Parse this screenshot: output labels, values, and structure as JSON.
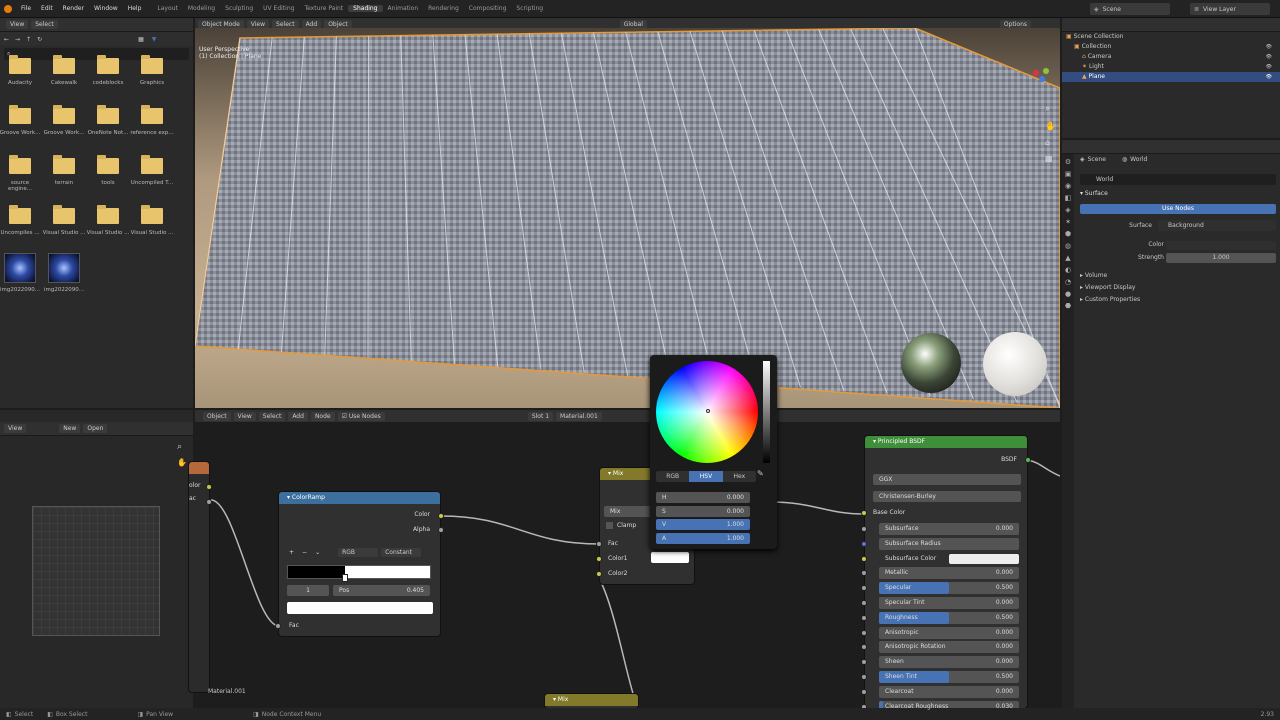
{
  "topbar": {
    "menu": [
      "File",
      "Edit",
      "Render",
      "Window",
      "Help"
    ],
    "workspaces": [
      "Layout",
      "Modeling",
      "Sculpting",
      "UV Editing",
      "Texture Paint",
      "Shading",
      "Animation",
      "Rendering",
      "Compositing",
      "Scripting"
    ],
    "active_workspace": "Shading",
    "scene": "Scene",
    "view_layer": "View Layer"
  },
  "file_browser": {
    "menu": [
      "View",
      "Select"
    ],
    "files": [
      "Audacity",
      "Cakewalk",
      "codeblocks",
      "Graphics",
      "Groove Work...",
      "Groove Work...",
      "OneNote Not...",
      "reference exp...",
      "source engine...",
      "terrain",
      "tools",
      "Uncompiled T...",
      "Uncompiles ...",
      "Visual Studio ...",
      "Visual Studio ...",
      "Visual Studio ..."
    ],
    "images": [
      "img2022090...",
      "img2022090..."
    ]
  },
  "viewport": {
    "mode": "Object Mode",
    "menu": [
      "View",
      "Select",
      "Add",
      "Object"
    ],
    "info_line1": "User Perspective",
    "info_line2": "(1) Collection | Plane",
    "orientation": "Global",
    "options": "Options"
  },
  "outliner": {
    "items": [
      "Scene Collection",
      "Collection",
      "Camera",
      "Light",
      "Plane"
    ]
  },
  "properties": {
    "scene_tab": "Scene",
    "world_tab": "World",
    "world_name": "World",
    "surface_section": "Surface",
    "use_nodes": "Use Nodes",
    "surface_label": "Surface",
    "surface_value": "Background",
    "color_label": "Color",
    "strength_label": "Strength",
    "strength_value": "1.000",
    "sections": [
      "Volume",
      "Viewport Display",
      "Custom Properties"
    ]
  },
  "image_editor": {
    "view": "View",
    "new": "New",
    "open": "Open"
  },
  "node_editor": {
    "header": [
      "Object",
      "View",
      "Select",
      "Add",
      "Node",
      "Use Nodes"
    ],
    "slot": "Slot 1",
    "material": "Material.001",
    "material_footer": "Material.001"
  },
  "left_node": {
    "out1": "olor",
    "out2": "ac"
  },
  "color_ramp": {
    "title": "ColorRamp",
    "out_color": "Color",
    "out_alpha": "Alpha",
    "mode": "RGB",
    "interp": "Constant",
    "index": "1",
    "pos_label": "Pos",
    "pos_value": "0.405",
    "in_fac": "Fac"
  },
  "mix_node": {
    "title": "Mix",
    "blend": "Mix",
    "clamp": "Clamp",
    "fac": "Fac",
    "color1": "Color1",
    "color2": "Color2",
    "bottom_title": "Mix"
  },
  "color_picker": {
    "tabs": [
      "RGB",
      "HSV",
      "Hex"
    ],
    "active_tab": "HSV",
    "fields": [
      {
        "label": "H",
        "value": "0.000",
        "active": false
      },
      {
        "label": "S",
        "value": "0.000",
        "active": false
      },
      {
        "label": "V",
        "value": "1.000",
        "active": true
      },
      {
        "label": "A",
        "value": "1.000",
        "active": true
      }
    ]
  },
  "bsdf": {
    "title": "Principled BSDF",
    "output": "BSDF",
    "distribution": "GGX",
    "subsurface_method": "Christensen-Burley",
    "base_color": "Base Color",
    "props": [
      {
        "label": "Subsurface",
        "value": "0.000",
        "fill": 0,
        "socket": "grey"
      },
      {
        "label": "Subsurface Radius",
        "value": "",
        "fill": 0,
        "socket": "blue"
      },
      {
        "label": "Subsurface Color",
        "value": "",
        "fill": 0,
        "socket": "yellow"
      },
      {
        "label": "Metallic",
        "value": "0.000",
        "fill": 0,
        "socket": "grey"
      },
      {
        "label": "Specular",
        "value": "0.500",
        "fill": 0.5,
        "socket": "grey"
      },
      {
        "label": "Specular Tint",
        "value": "0.000",
        "fill": 0,
        "socket": "grey"
      },
      {
        "label": "Roughness",
        "value": "0.500",
        "fill": 0.5,
        "socket": "grey"
      },
      {
        "label": "Anisotropic",
        "value": "0.000",
        "fill": 0,
        "socket": "grey"
      },
      {
        "label": "Anisotropic Rotation",
        "value": "0.000",
        "fill": 0,
        "socket": "grey"
      },
      {
        "label": "Sheen",
        "value": "0.000",
        "fill": 0,
        "socket": "grey"
      },
      {
        "label": "Sheen Tint",
        "value": "0.500",
        "fill": 0.5,
        "socket": "grey"
      },
      {
        "label": "Clearcoat",
        "value": "0.000",
        "fill": 0,
        "socket": "grey"
      },
      {
        "label": "Clearcoat Roughness",
        "value": "0.030",
        "fill": 0.03,
        "socket": "grey"
      }
    ]
  },
  "statusbar": {
    "select": "Select",
    "box_select": "Box Select",
    "pan_view": "Pan View",
    "context_menu": "Node Context Menu",
    "version": "2.93"
  }
}
